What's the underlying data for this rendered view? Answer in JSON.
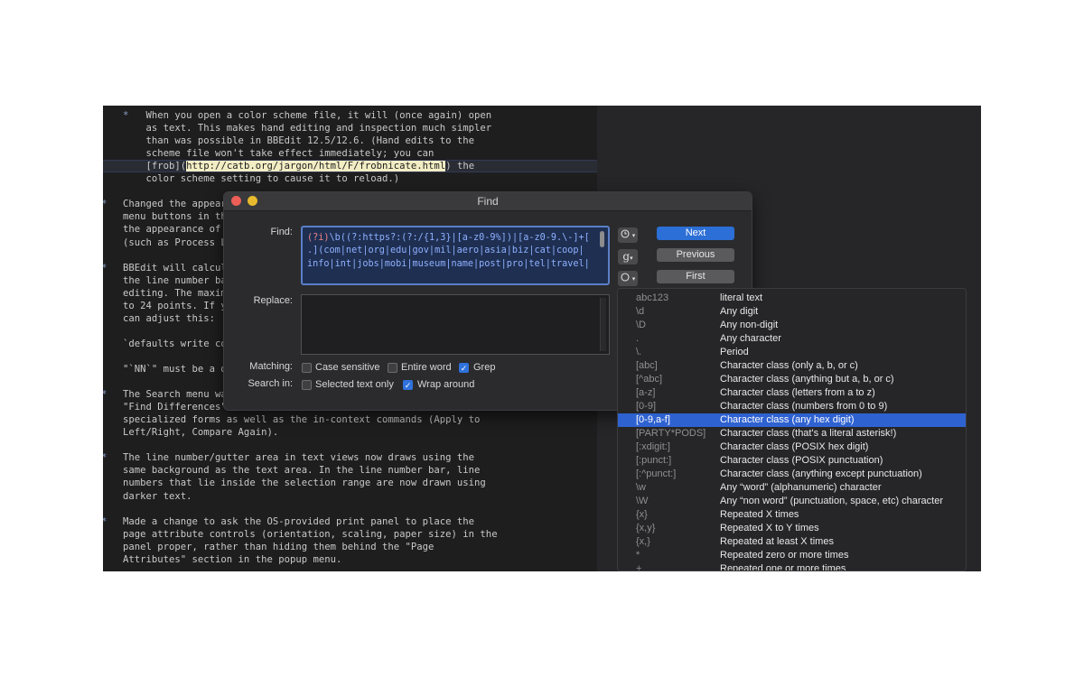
{
  "editor": {
    "lines": [
      "    When you open a color scheme file, it will (once again) open",
      "    as text. This makes hand editing and inspection much simpler",
      "    than was possible in BBEdit 12.5/12.6. (Hand edits to the",
      "    scheme file won't take effect immediately; you can",
      "",
      "    color scheme setting to cause it to reload.)",
      "",
      "Changed the appear",
      "menu buttons in th",
      "the appearance of",
      "(such as Process L",
      "",
      "BBEdit will calcul",
      "the line number ba",
      "editing. The maxim",
      "to 24 points. If y",
      "can adjust this:",
      "",
      "`defaults write co",
      "",
      "\"`NN`\" must be a d",
      "",
      "The Search menu wa",
      "\"Find Differences\"",
      "specialized forms as well as the in-context commands (Apply to",
      "Left/Right, Compare Again).",
      "",
      "The line number/gutter area in text views now draws using the",
      "same background as the text area. In the line number bar, line",
      "numbers that lie inside the selection range are now drawn using",
      "darker text.",
      "",
      "Made a change to ask the OS-provided print panel to place the",
      "page attribute controls (orientation, scaling, paper size) in the",
      "panel proper, rather than hiding them behind the \"Page",
      "Attributes\" section in the popup menu."
    ],
    "link_line": {
      "prefix": "    [frob](",
      "url": "http://catb.org/jargon/html/F/frobnicate.html",
      "suffix": ") the"
    },
    "bullet": "*"
  },
  "find_window": {
    "title": "Find",
    "find_label": "Find:",
    "replace_label": "Replace:",
    "find_value": {
      "l1a": "(?i)",
      "l1b": "\\b((?:https?:(?:/{1,3}|[a-z0-9%])|[a-z0-9.\\-]+[",
      "l2": ".](com|net|org|edu|gov|mil|aero|asia|biz|cat|coop|",
      "l3": "info|int|jobs|mobi|museum|name|post|pro|tel|travel|"
    },
    "replace_value": "",
    "buttons": {
      "next": "Next",
      "previous": "Previous",
      "first": "First"
    },
    "icons": {
      "history": "clock-icon",
      "grep": "g",
      "help": "?"
    },
    "matching_label": "Matching:",
    "search_in_label": "Search in:",
    "options": {
      "case_sensitive": {
        "label": "Case sensitive",
        "checked": false
      },
      "entire_word": {
        "label": "Entire word",
        "checked": false
      },
      "grep": {
        "label": "Grep",
        "checked": true
      },
      "selected_text_only": {
        "label": "Selected text only",
        "checked": false
      },
      "wrap_around": {
        "label": "Wrap around",
        "checked": true
      }
    },
    "check_glyph": "✓"
  },
  "grep_menu": {
    "items": [
      {
        "pattern": "abc123",
        "desc": "literal text"
      },
      {
        "pattern": "\\d",
        "desc": "Any digit"
      },
      {
        "pattern": "\\D",
        "desc": "Any non-digit"
      },
      {
        "pattern": ".",
        "desc": "Any character"
      },
      {
        "pattern": "\\.",
        "desc": "Period"
      },
      {
        "pattern": "[abc]",
        "desc": "Character class (only a, b, or c)"
      },
      {
        "pattern": "[^abc]",
        "desc": "Character class (anything but a, b, or c)"
      },
      {
        "pattern": "[a-z]",
        "desc": "Character class (letters from a to z)"
      },
      {
        "pattern": "[0-9]",
        "desc": "Character class (numbers from 0 to 9)"
      },
      {
        "pattern": "[0-9,a-f]",
        "desc": "Character class (any hex digit)"
      },
      {
        "pattern": "[PARTY*PODS]",
        "desc": "Character class (that's a literal asterisk!)"
      },
      {
        "pattern": "[:xdigit:]",
        "desc": "Character class (POSIX hex digit)"
      },
      {
        "pattern": "[:punct:]",
        "desc": "Character class (POSIX punctuation)"
      },
      {
        "pattern": "[:^punct:]",
        "desc": "Character class (anything except punctuation)"
      },
      {
        "pattern": "\\w",
        "desc": "Any “word” (alphanumeric) character"
      },
      {
        "pattern": "\\W",
        "desc": "Any “non word” (punctuation, space, etc) character"
      },
      {
        "pattern": "{x}",
        "desc": "Repeated X times"
      },
      {
        "pattern": "{x,y}",
        "desc": "Repeated X to Y times"
      },
      {
        "pattern": "{x,}",
        "desc": "Repeated at least X times"
      },
      {
        "pattern": "*",
        "desc": "Repeated zero or more times"
      },
      {
        "pattern": "+",
        "desc": "Repeated one or more times"
      }
    ],
    "selected_index": 9
  },
  "colors": {
    "accent": "#2f62d1",
    "close": "#ec5f57",
    "minimize": "#e8bb2e",
    "link_bg": "#f3edc4"
  }
}
